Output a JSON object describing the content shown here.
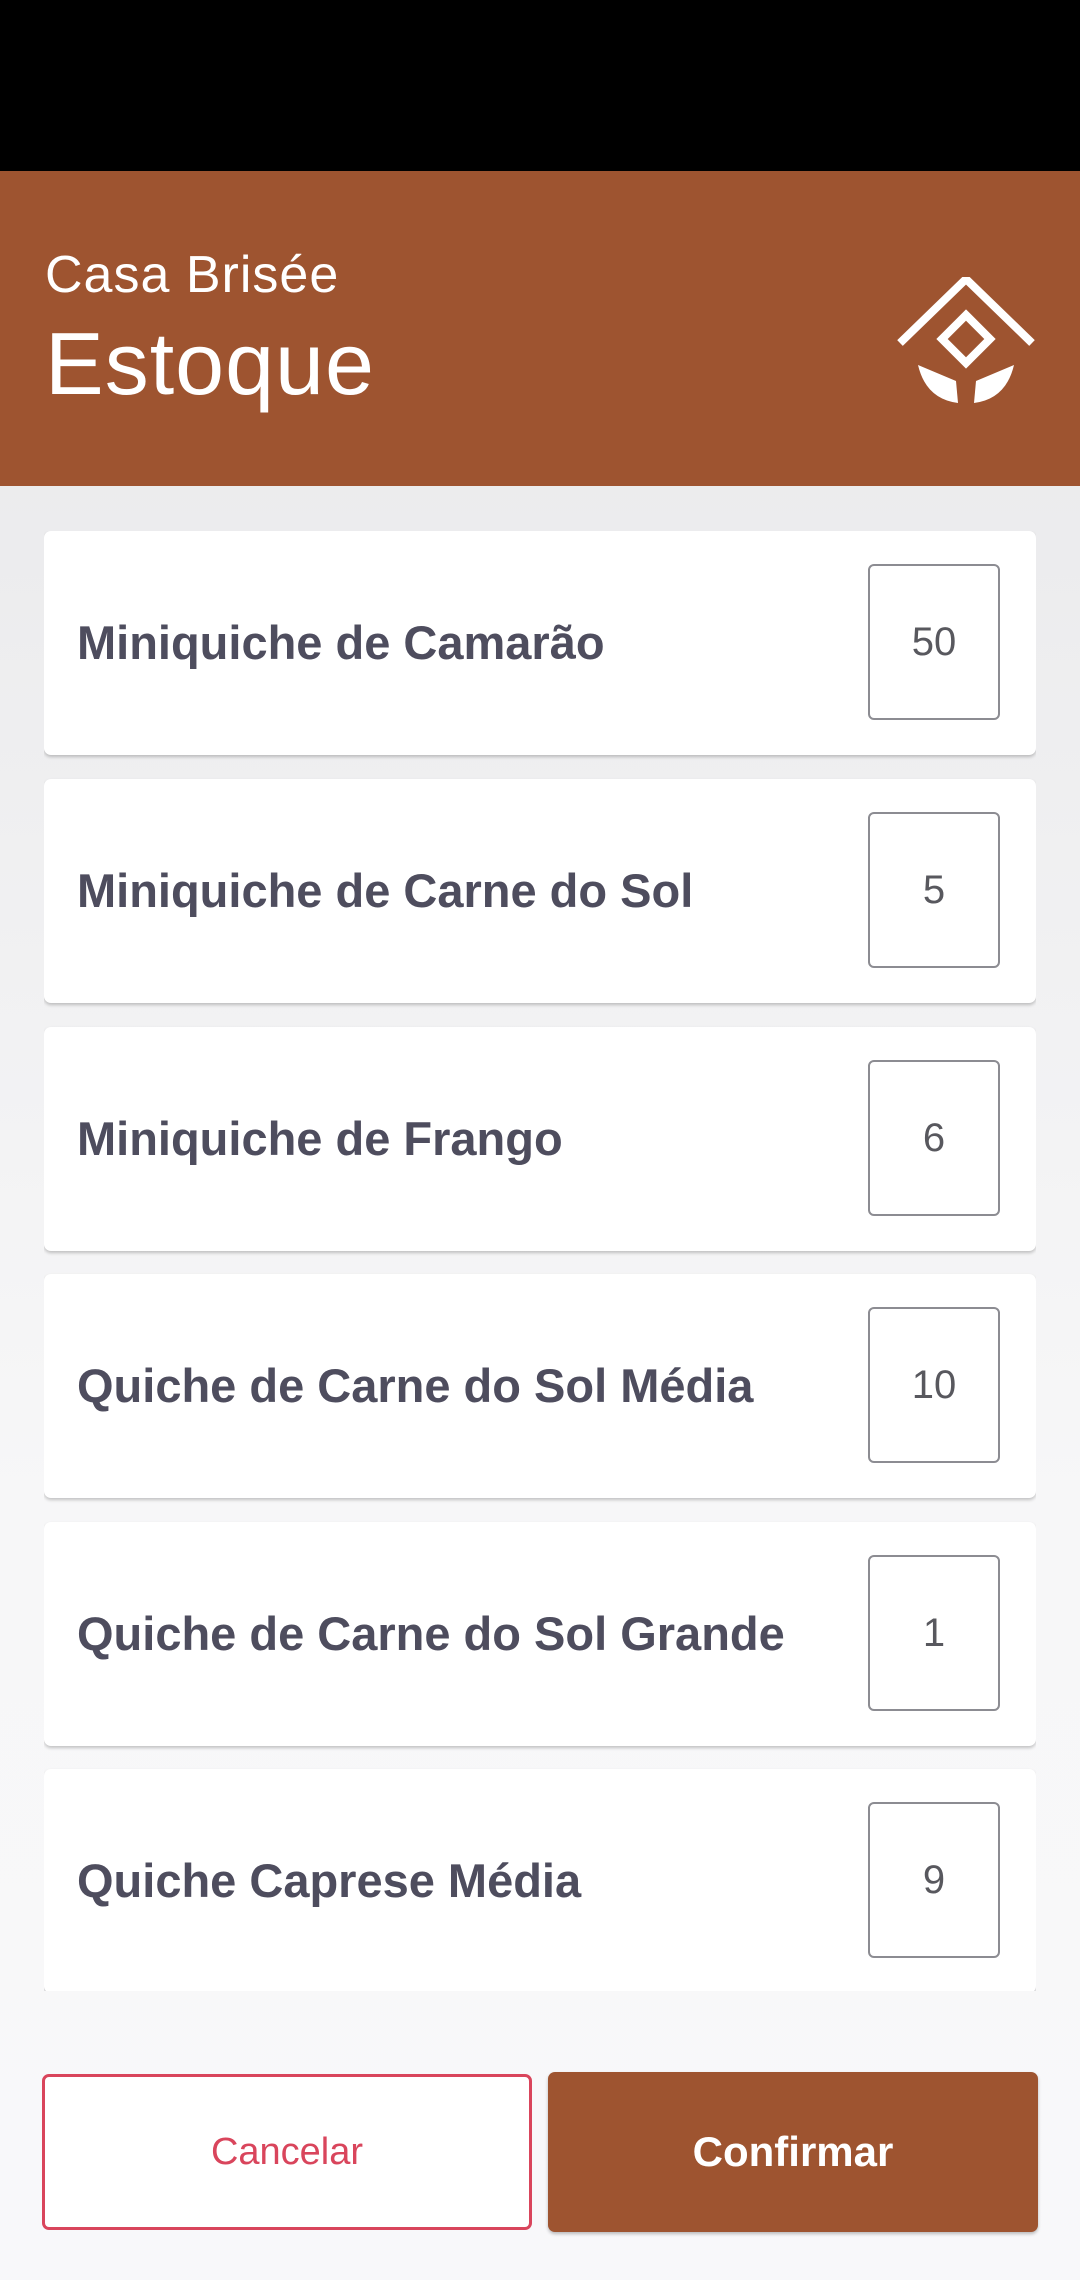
{
  "header": {
    "brand": "Casa Brisée",
    "title": "Estoque",
    "logo_icon": "house-diamond-logo-icon",
    "color": "#9e5430"
  },
  "items": [
    {
      "name": "Miniquiche de Camarão",
      "quantity": "50"
    },
    {
      "name": "Miniquiche de Carne do Sol",
      "quantity": "5"
    },
    {
      "name": "Miniquiche de Frango",
      "quantity": "6"
    },
    {
      "name": "Quiche de Carne do Sol Média",
      "quantity": "10"
    },
    {
      "name": "Quiche de Carne do Sol Grande",
      "quantity": "1"
    },
    {
      "name": "Quiche Caprese Média",
      "quantity": "9"
    }
  ],
  "actions": {
    "cancel_label": "Cancelar",
    "confirm_label": "Confirmar",
    "cancel_color": "#d9455c",
    "confirm_color": "#9e5430"
  }
}
